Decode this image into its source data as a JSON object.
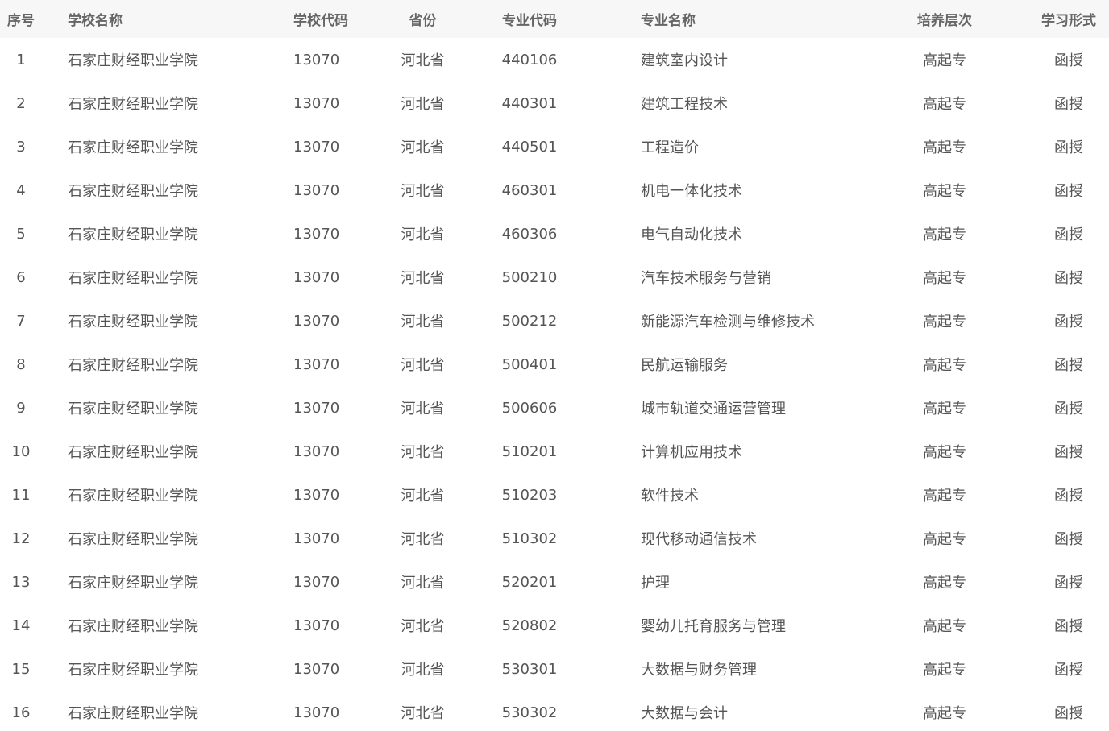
{
  "table": {
    "headers": [
      "序号",
      "学校名称",
      "学校代码",
      "省份",
      "专业代码",
      "专业名称",
      "培养层次",
      "学习形式"
    ],
    "rows": [
      [
        "1",
        "石家庄财经职业学院",
        "13070",
        "河北省",
        "440106",
        "建筑室内设计",
        "高起专",
        "函授"
      ],
      [
        "2",
        "石家庄财经职业学院",
        "13070",
        "河北省",
        "440301",
        "建筑工程技术",
        "高起专",
        "函授"
      ],
      [
        "3",
        "石家庄财经职业学院",
        "13070",
        "河北省",
        "440501",
        "工程造价",
        "高起专",
        "函授"
      ],
      [
        "4",
        "石家庄财经职业学院",
        "13070",
        "河北省",
        "460301",
        "机电一体化技术",
        "高起专",
        "函授"
      ],
      [
        "5",
        "石家庄财经职业学院",
        "13070",
        "河北省",
        "460306",
        "电气自动化技术",
        "高起专",
        "函授"
      ],
      [
        "6",
        "石家庄财经职业学院",
        "13070",
        "河北省",
        "500210",
        "汽车技术服务与营销",
        "高起专",
        "函授"
      ],
      [
        "7",
        "石家庄财经职业学院",
        "13070",
        "河北省",
        "500212",
        "新能源汽车检测与维修技术",
        "高起专",
        "函授"
      ],
      [
        "8",
        "石家庄财经职业学院",
        "13070",
        "河北省",
        "500401",
        "民航运输服务",
        "高起专",
        "函授"
      ],
      [
        "9",
        "石家庄财经职业学院",
        "13070",
        "河北省",
        "500606",
        "城市轨道交通运营管理",
        "高起专",
        "函授"
      ],
      [
        "10",
        "石家庄财经职业学院",
        "13070",
        "河北省",
        "510201",
        "计算机应用技术",
        "高起专",
        "函授"
      ],
      [
        "11",
        "石家庄财经职业学院",
        "13070",
        "河北省",
        "510203",
        "软件技术",
        "高起专",
        "函授"
      ],
      [
        "12",
        "石家庄财经职业学院",
        "13070",
        "河北省",
        "510302",
        "现代移动通信技术",
        "高起专",
        "函授"
      ],
      [
        "13",
        "石家庄财经职业学院",
        "13070",
        "河北省",
        "520201",
        "护理",
        "高起专",
        "函授"
      ],
      [
        "14",
        "石家庄财经职业学院",
        "13070",
        "河北省",
        "520802",
        "婴幼儿托育服务与管理",
        "高起专",
        "函授"
      ],
      [
        "15",
        "石家庄财经职业学院",
        "13070",
        "河北省",
        "530301",
        "大数据与财务管理",
        "高起专",
        "函授"
      ],
      [
        "16",
        "石家庄财经职业学院",
        "13070",
        "河北省",
        "530302",
        "大数据与会计",
        "高起专",
        "函授"
      ]
    ]
  },
  "colors": {
    "header_bg": "#f7f7f7",
    "header_text": "#666666",
    "cell_text": "#555555",
    "background": "#ffffff"
  }
}
